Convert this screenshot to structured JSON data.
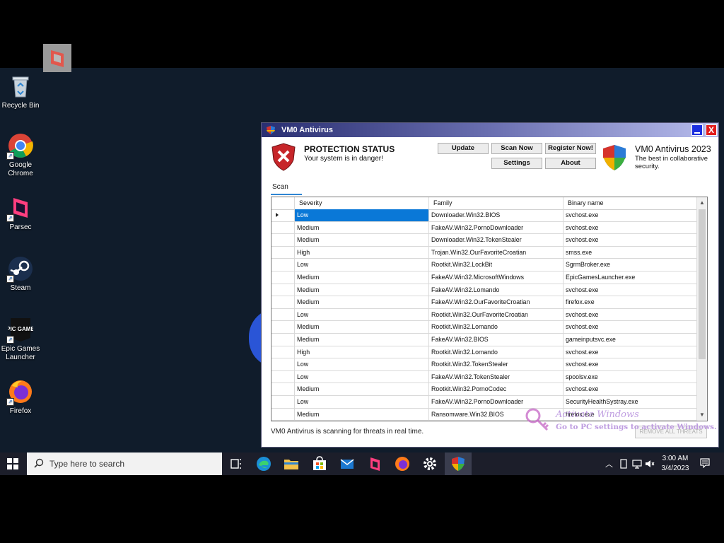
{
  "desktop": {
    "icons": [
      {
        "label": "Recycle Bin",
        "icon": "recycle-bin-icon"
      },
      {
        "label": "Google Chrome",
        "icon": "chrome-icon"
      },
      {
        "label": "Parsec",
        "icon": "parsec-icon"
      },
      {
        "label": "Steam",
        "icon": "steam-icon"
      },
      {
        "label": "Epic Games Launcher",
        "icon": "epic-games-icon"
      },
      {
        "label": "Firefox",
        "icon": "firefox-icon"
      }
    ],
    "epic_logo_text": "EPIC GAMES"
  },
  "window": {
    "title": "VM0 Antivirus",
    "close_glyph": "X",
    "protection_title": "PROTECTION STATUS",
    "protection_subtitle": "Your system is in danger!",
    "buttons": {
      "update": "Update",
      "scan_now": "Scan Now",
      "register": "Register Now!",
      "settings": "Settings",
      "about": "About"
    },
    "brand_title": "VM0 Antivirus 2023",
    "brand_subtitle": "The best in collaborative security.",
    "tab_label": "Scan",
    "columns": [
      "Severity",
      "Family",
      "Binary name"
    ],
    "rows": [
      [
        "Low",
        "Downloader.Win32.BIOS",
        "svchost.exe"
      ],
      [
        "Medium",
        "FakeAV.Win32.PornoDownloader",
        "svchost.exe"
      ],
      [
        "Medium",
        "Downloader.Win32.TokenStealer",
        "svchost.exe"
      ],
      [
        "High",
        "Trojan.Win32.OurFavoriteCroatian",
        "smss.exe"
      ],
      [
        "Low",
        "Rootkit.Win32.LockBit",
        "SgrmBroker.exe"
      ],
      [
        "Medium",
        "FakeAV.Win32.MicrosoftWindows",
        "EpicGamesLauncher.exe"
      ],
      [
        "Medium",
        "FakeAV.Win32.Lomando",
        "svchost.exe"
      ],
      [
        "Medium",
        "FakeAV.Win32.OurFavoriteCroatian",
        "firefox.exe"
      ],
      [
        "Low",
        "Rootkit.Win32.OurFavoriteCroatian",
        "svchost.exe"
      ],
      [
        "Medium",
        "Rootkit.Win32.Lomando",
        "svchost.exe"
      ],
      [
        "Medium",
        "FakeAV.Win32.BIOS",
        "gameinputsvc.exe"
      ],
      [
        "High",
        "Rootkit.Win32.Lomando",
        "svchost.exe"
      ],
      [
        "Low",
        "Rootkit.Win32.TokenStealer",
        "svchost.exe"
      ],
      [
        "Low",
        "FakeAV.Win32.TokenStealer",
        "spoolsv.exe"
      ],
      [
        "Medium",
        "Rootkit.Win32.PornoCodec",
        "svchost.exe"
      ],
      [
        "Low",
        "FakeAV.Win32.PornoDownloader",
        "SecurityHealthSystray.exe"
      ],
      [
        "Medium",
        "Ransomware.Win32.BIOS",
        "firefox.exe"
      ]
    ],
    "status_text": "VM0 Antivirus is scanning for threats in real time.",
    "remove_button": "REMOVE ALL THREATS",
    "activate_title": "Activate Windows",
    "activate_sub": "Go to PC settings to activate Windows."
  },
  "taskbar": {
    "search_placeholder": "Type here to search",
    "apps": [
      "task-view-icon",
      "edge-icon",
      "file-explorer-icon",
      "store-icon",
      "mail-icon",
      "parsec-icon",
      "firefox-icon",
      "settings-gear-icon",
      "vm0-antivirus-icon"
    ],
    "time": "3:00 AM",
    "date": "3/4/2023"
  },
  "colors": {
    "selection": "#0a78d7",
    "title_bar_start": "#2a2f72",
    "desktop": "#101c2b",
    "taskbar": "#1c1e2a"
  }
}
